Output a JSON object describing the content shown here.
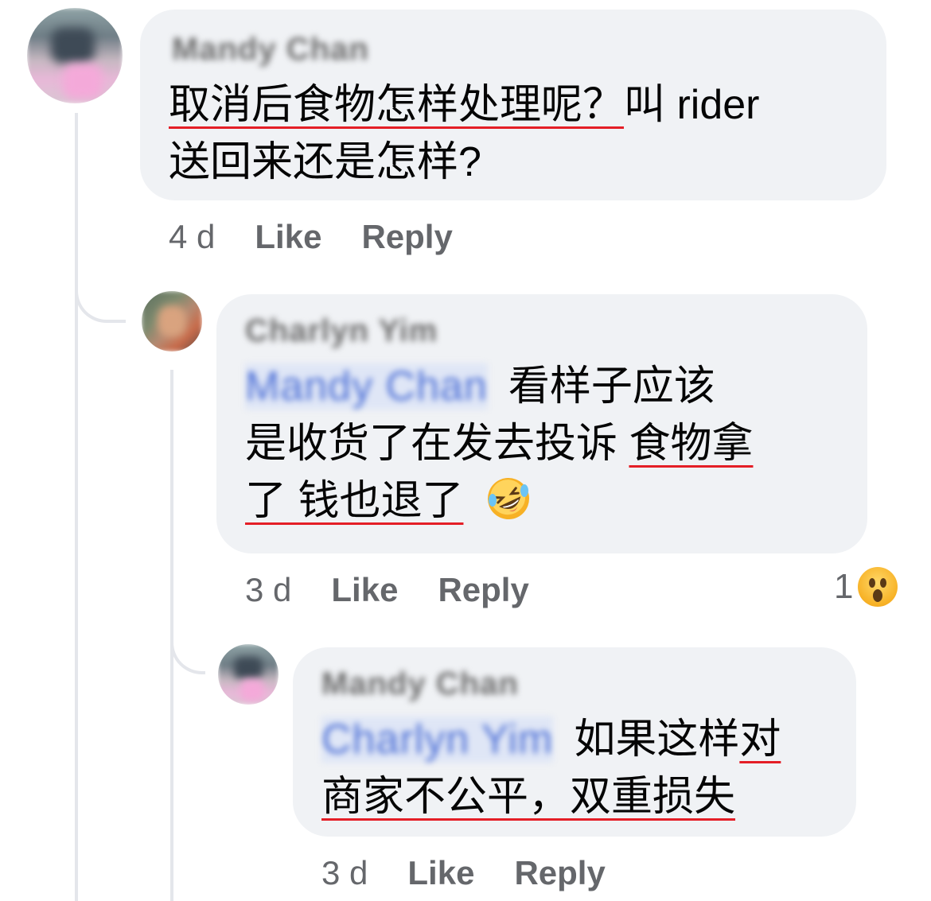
{
  "comments": [
    {
      "author": "Mandy Chan",
      "text_lines": [
        {
          "underlined": "取消后食物怎样处理呢？",
          "plain": "叫 rider"
        },
        {
          "plain": "送回来还是怎样?"
        }
      ],
      "time": "4 d",
      "like": "Like",
      "reply": "Reply"
    },
    {
      "author": "Charlyn Yim",
      "mention": "Mandy Chan",
      "line1": "看样子应该",
      "line2_plain": "是收货了在发去投诉 ",
      "line2_ul": "食物拿",
      "line3_ul": "了 钱也退了",
      "emoji": "rofl-emoji",
      "time": "3 d",
      "like": "Like",
      "reply": "Reply",
      "reaction_count": "1",
      "reaction_icon": "wow-emoji"
    },
    {
      "author": "Mandy Chan",
      "mention": "Charlyn Yim",
      "line1_plain": "如果这样",
      "line1_ul": "对",
      "line2_ul": "商家不公平，双重损失",
      "time": "3 d",
      "like": "Like",
      "reply": "Reply"
    }
  ]
}
